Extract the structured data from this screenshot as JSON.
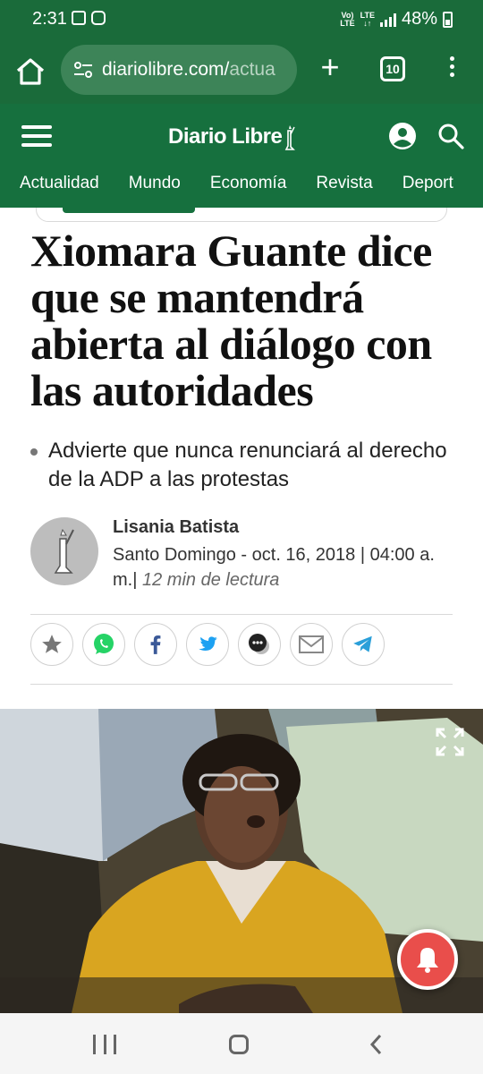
{
  "status_bar": {
    "time": "2:31",
    "network_line1": "Vo)",
    "network_line2": "LTE",
    "lte_top": "LTE",
    "battery_percent": "48%"
  },
  "browser": {
    "url_main": "diariolibre.com/",
    "url_dim": "actua",
    "tab_count": "10"
  },
  "site": {
    "logo_text": "Diario Libre",
    "nav": [
      "Actualidad",
      "Mundo",
      "Economía",
      "Revista",
      "Deport"
    ]
  },
  "article": {
    "headline": "Xiomara Guante dice que se mantendrá abierta al diálogo con las autoridades",
    "summary": "Advierte que nunca renunciará al derecho de la ADP a las protestas",
    "author": "Lisania Batista",
    "location_date": "Santo Domingo - oct. 16, 2018 | 04:00 a. m.",
    "separator": "|",
    "read_time": "12 min de lectura"
  },
  "share_icons": [
    "star-icon",
    "whatsapp-icon",
    "facebook-icon",
    "twitter-icon",
    "message-icon",
    "email-icon",
    "telegram-icon"
  ],
  "colors": {
    "brand_green": "#16703e",
    "notification_red": "#e94e4b"
  }
}
